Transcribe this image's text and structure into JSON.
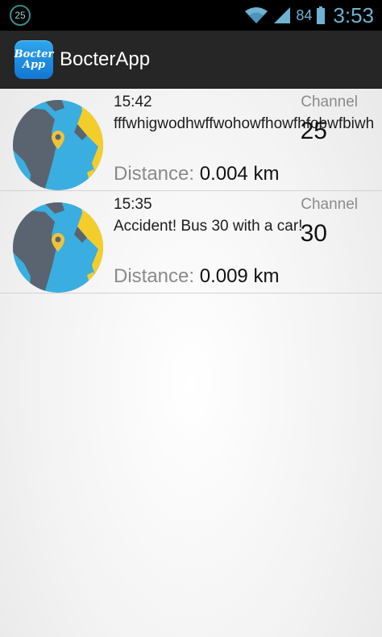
{
  "status_bar": {
    "notification_count": "25",
    "battery_level": "84",
    "clock": "3:53",
    "icons": [
      "wifi-icon",
      "signal-icon",
      "battery-icon"
    ]
  },
  "action_bar": {
    "logo_text_line1": "Bocter",
    "logo_text_line2": "App",
    "title": "BocterApp"
  },
  "alerts": [
    {
      "time": "15:42",
      "channel_label": "Channel",
      "message": "fffwhigwodhwffwohowfhowfhfobwfbiwh",
      "channel_number": "25",
      "distance_label": "Distance:",
      "distance_value": "0.004 km"
    },
    {
      "time": "15:35",
      "channel_label": "Channel",
      "message": "Accident! Bus 30 with a car!",
      "channel_number": "30",
      "distance_label": "Distance:",
      "distance_value": "0.009 km"
    }
  ],
  "colors": {
    "status_bar": "#000000",
    "action_bar": "#262626",
    "status_accent": "#6fb2d2",
    "globe_ocean": "#3aaee0",
    "globe_land": "#5a6470",
    "globe_sun_land": "#f4cd2a",
    "pin": "#f0c23a"
  }
}
